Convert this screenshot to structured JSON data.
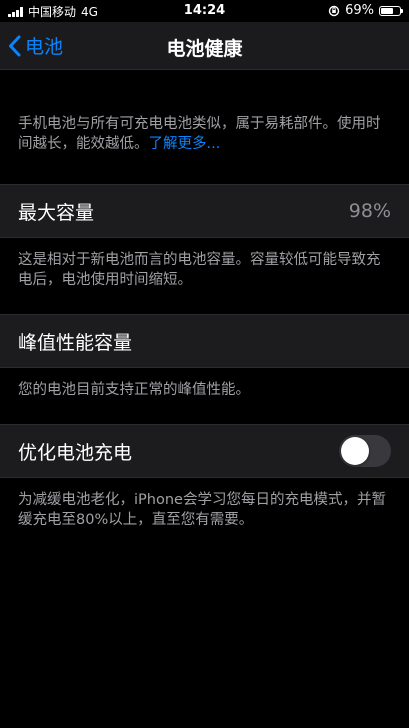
{
  "status_bar": {
    "carrier": "中国移动",
    "network": "4G",
    "time": "14:24",
    "battery_percent": "69%",
    "battery_level": 0.69
  },
  "nav": {
    "back_label": "电池",
    "title": "电池健康"
  },
  "intro": {
    "text": "手机电池与所有可充电电池类似，属于易耗部件。使用时间越长，能效越低。",
    "link": "了解更多..."
  },
  "max_capacity": {
    "label": "最大容量",
    "value": "98%",
    "footer": "这是相对于新电池而言的电池容量。容量较低可能导致充电后，电池使用时间缩短。"
  },
  "peak_performance": {
    "label": "峰值性能容量",
    "footer": "您的电池目前支持正常的峰值性能。"
  },
  "optimized_charging": {
    "label": "优化电池充电",
    "enabled": false,
    "footer": "为减缓电池老化，iPhone会学习您每日的充电模式，并暂缓充电至80%以上，直至您有需要。"
  },
  "colors": {
    "accent": "#0a84ff",
    "background": "#000000",
    "cell": "#1c1c1e",
    "secondary_text": "#a0a0a5"
  }
}
